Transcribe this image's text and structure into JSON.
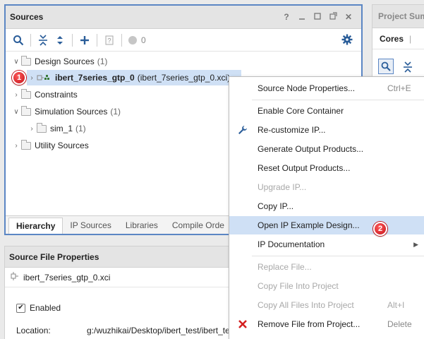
{
  "sources": {
    "title": "Sources",
    "win_buttons": [
      "?",
      "–",
      "□",
      "⧉",
      "✕"
    ],
    "toolbar": {
      "count": "0"
    },
    "tree": [
      {
        "label": "Design Sources",
        "count": "(1)",
        "expanded": true
      },
      {
        "badge": "1",
        "label": "ibert_7series_gtp_0",
        "file": "(ibert_7series_gtp_0.xci)"
      },
      {
        "label": "Constraints"
      },
      {
        "label": "Simulation Sources",
        "count": "(1)",
        "expanded": true
      },
      {
        "label": "sim_1",
        "count": "(1)"
      },
      {
        "label": "Utility Sources"
      }
    ],
    "tabs": [
      "Hierarchy",
      "IP Sources",
      "Libraries",
      "Compile Orde"
    ]
  },
  "props": {
    "title": "Source File Properties",
    "file": "ibert_7series_gtp_0.xci",
    "enabled_label": "Enabled",
    "enabled": true,
    "location_label": "Location:",
    "location_value": "g:/wuzhikai/Desktop/ibert_test/ibert_te"
  },
  "summary": {
    "title": "Project Summ",
    "tab_cores": "Cores",
    "pipe": "|"
  },
  "menu": {
    "items": [
      {
        "label": "Source Node Properties...",
        "shortcut": "Ctrl+E"
      },
      {
        "label": "Enable Core Container"
      },
      {
        "label": "Re-customize IP...",
        "icon": "wrench-icon"
      },
      {
        "label": "Generate Output Products..."
      },
      {
        "label": "Reset Output Products..."
      },
      {
        "label": "Upgrade IP...",
        "disabled": true
      },
      {
        "label": "Copy IP..."
      },
      {
        "label": "Open IP Example Design...",
        "highlighted": true,
        "badge": "2"
      },
      {
        "label": "IP Documentation",
        "submenu": true
      },
      {
        "label": "Replace File...",
        "disabled": true
      },
      {
        "label": "Copy File Into Project",
        "disabled": true
      },
      {
        "label": "Copy All Files Into Project",
        "shortcut": "Alt+I",
        "disabled": true
      },
      {
        "label": "Remove File from Project...",
        "shortcut": "Delete",
        "icon": "delete-x-icon"
      }
    ]
  },
  "colors": {
    "accent": "#2a5d99",
    "selection": "#cfe0f5",
    "badge": "#d0171f",
    "delete": "#d42020"
  }
}
